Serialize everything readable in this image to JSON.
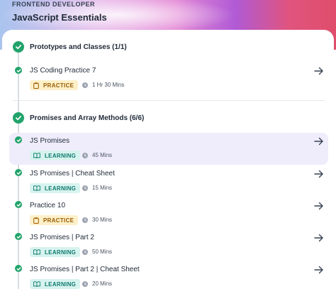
{
  "header": {
    "eyebrow": "FRONTEND DEVELOPER",
    "course_title": "JavaScript Essentials"
  },
  "sections": [
    {
      "title": "Prototypes and Classes (1/1)",
      "items": [
        {
          "title": "JS Coding Practice 7",
          "type": "PRACTICE",
          "duration": "1 Hr 30 Mins",
          "active": false
        }
      ]
    },
    {
      "title": "Promises and Array Methods (6/6)",
      "items": [
        {
          "title": "JS Promises",
          "type": "LEARNING",
          "duration": "45 Mins",
          "active": true
        },
        {
          "title": "JS Promises | Cheat Sheet",
          "type": "LEARNING",
          "duration": "15 Mins",
          "active": false
        },
        {
          "title": "Practice 10",
          "type": "PRACTICE",
          "duration": "30 Mins",
          "active": false
        },
        {
          "title": "JS Promises | Part 2",
          "type": "LEARNING",
          "duration": "50 Mins",
          "active": false
        },
        {
          "title": "JS Promises | Part 2 | Cheat Sheet",
          "type": "LEARNING",
          "duration": "20 Mins",
          "active": false
        }
      ]
    }
  ],
  "colors": {
    "check_green": "#22a36b",
    "active_row_bg": "#efedfb",
    "practice_badge_bg": "#fdf0c9",
    "learning_badge_bg": "#d7f3ef"
  },
  "icons": {
    "section_status": "check-circle-icon",
    "item_status": "check-circle-icon",
    "practice_badge": "clipboard-icon",
    "learning_badge": "book-open-icon",
    "duration": "clock-icon",
    "open_item": "arrow-right-icon"
  }
}
